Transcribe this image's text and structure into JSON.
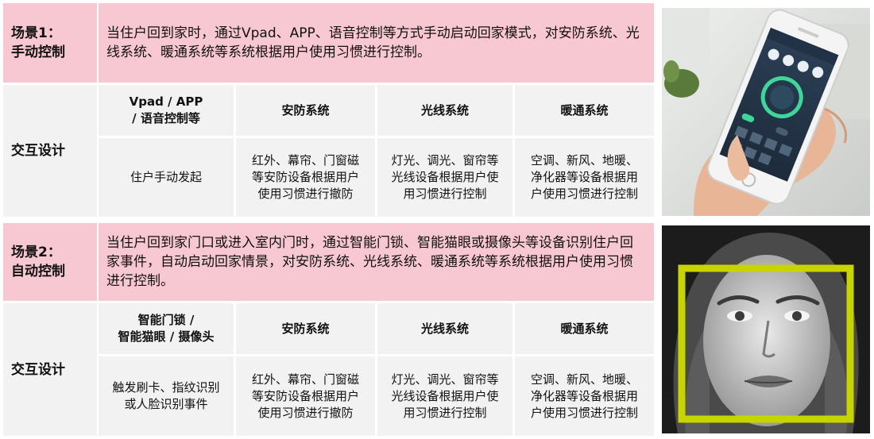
{
  "scene1": {
    "title_line1": "场景1：",
    "title_line2": "手动控制",
    "description": "当住户回到家时，通过Vpad、APP、语音控制等方式手动启动回家模式，对安防系统、光线系统、暖通系统等系统根据用户使用习惯进行控制。",
    "interaction_label": "交互设计",
    "columns": [
      {
        "header_line1": "Vpad / APP",
        "header_line2": "/ 语音控制等",
        "body": [
          "住户手动发起"
        ]
      },
      {
        "header_line1": "安防系统",
        "header_line2": "",
        "body": [
          "红外、幕帘、门窗磁",
          "等安防设备根据用户",
          "使用习惯进行撤防"
        ]
      },
      {
        "header_line1": "光线系统",
        "header_line2": "",
        "body": [
          "灯光、调光、窗帘等",
          "光线设备根据用户使",
          "用习惯进行控制"
        ]
      },
      {
        "header_line1": "暖通系统",
        "header_line2": "",
        "body": [
          "空调、新风、地暖、",
          "净化器等设备根据用",
          "户使用习惯进行控制"
        ]
      }
    ]
  },
  "scene2": {
    "title_line1": "场景2：",
    "title_line2": "自动控制",
    "description": "当住户回到家门口或进入室内门时，通过智能门锁、智能猫眼或摄像头等设备识别住户回家事件，自动启动回家情景，对安防系统、光线系统、暖通系统等系统根据用户使用习惯进行控制。",
    "interaction_label": "交互设计",
    "columns": [
      {
        "header_line1": "智能门锁 /",
        "header_line2": "智能猫眼 / 摄像头",
        "body": [
          "触发刷卡、指纹识别",
          "或人脸识别事件"
        ]
      },
      {
        "header_line1": "安防系统",
        "header_line2": "",
        "body": [
          "红外、幕帘、门窗磁",
          "等安防设备根据用户",
          "使用习惯进行撤防"
        ]
      },
      {
        "header_line1": "光线系统",
        "header_line2": "",
        "body": [
          "灯光、调光、窗帘等",
          "光线设备根据用户使",
          "用习惯进行控制"
        ]
      },
      {
        "header_line1": "暖通系统",
        "header_line2": "",
        "body": [
          "空调、新风、地暖、",
          "净化器等设备根据用",
          "户使用习惯进行控制"
        ]
      }
    ]
  },
  "colors": {
    "pink": "#f8c8d2",
    "grey": "#f2f2f2",
    "face_box": "#c8d400",
    "app_green": "#3fd69c"
  }
}
